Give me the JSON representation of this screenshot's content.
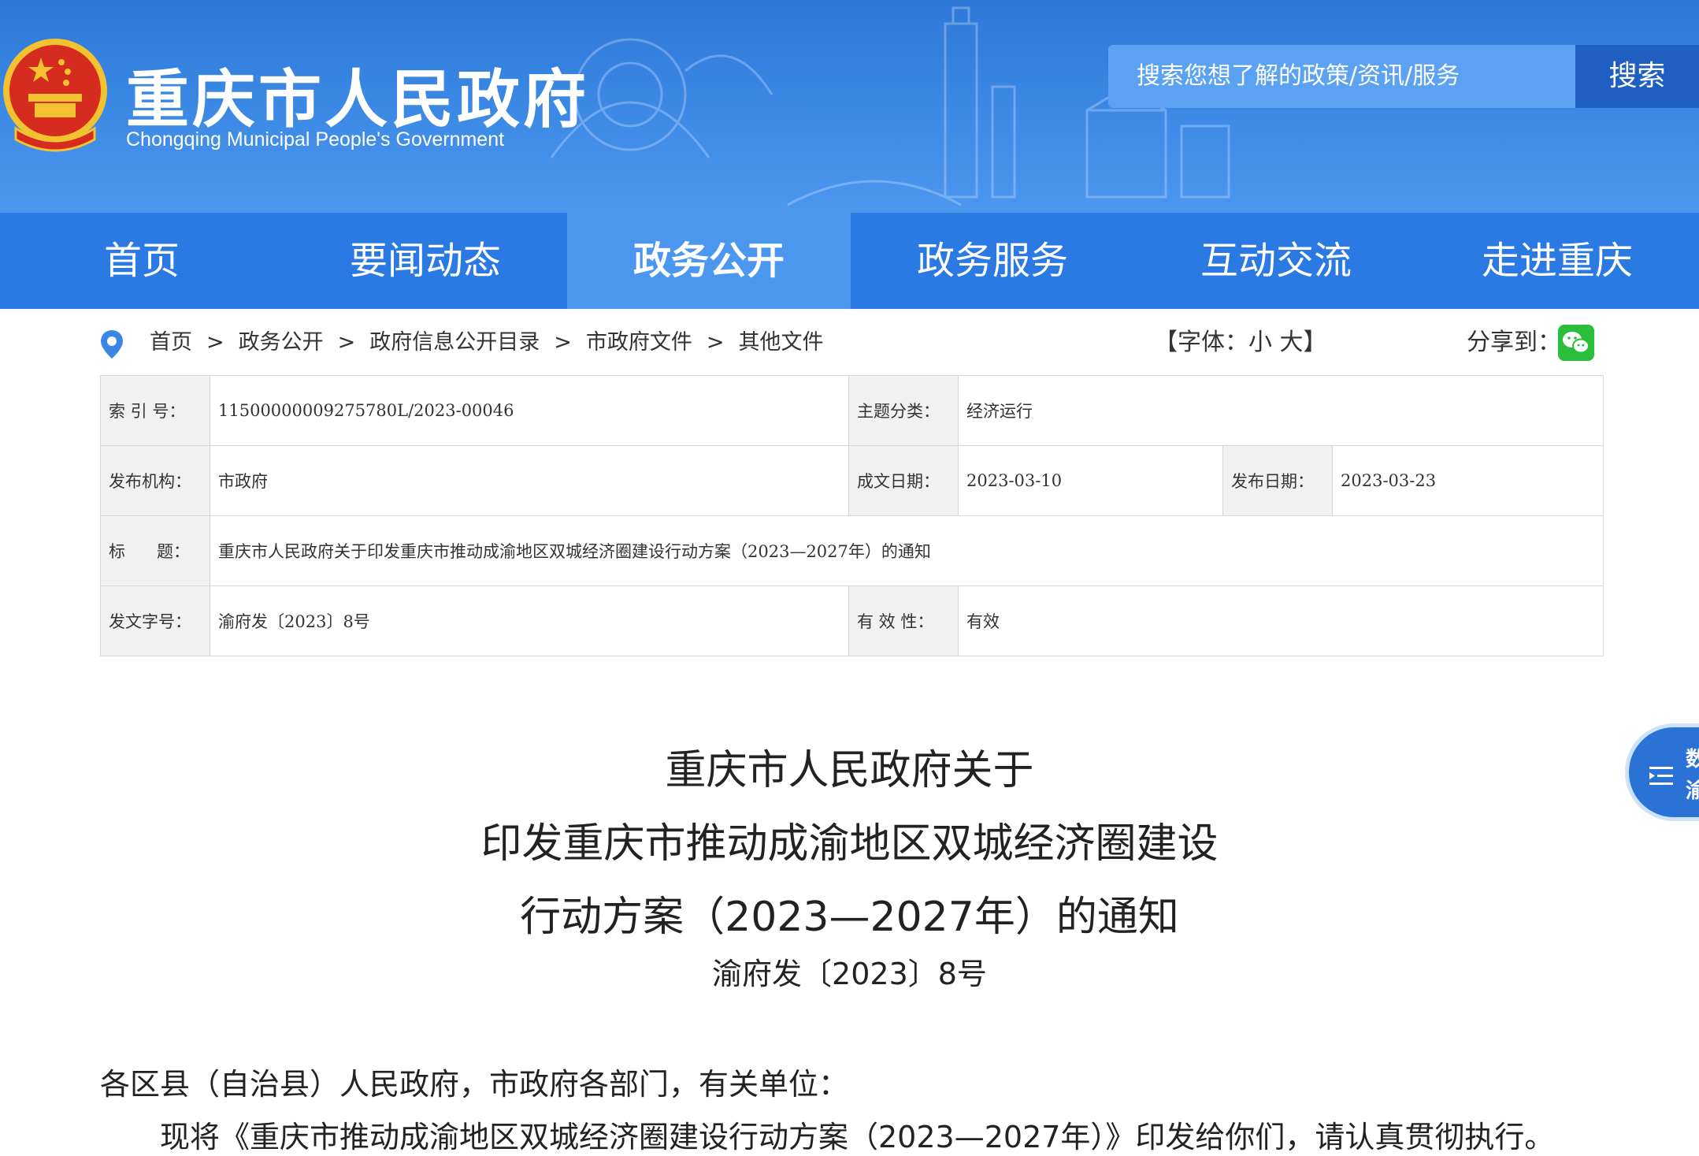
{
  "header": {
    "title": "重庆市人民政府",
    "subtitle": "Chongqing Municipal People's Government",
    "search_placeholder": "搜索您想了解的政策/资讯/服务",
    "search_button": "搜索"
  },
  "nav": {
    "items": [
      {
        "label": "首页"
      },
      {
        "label": "要闻动态"
      },
      {
        "label": "政务公开",
        "active": true
      },
      {
        "label": "政务服务"
      },
      {
        "label": "互动交流"
      },
      {
        "label": "走进重庆"
      }
    ]
  },
  "breadcrumb": {
    "items": [
      "首页",
      "政务公开",
      "政府信息公开目录",
      "市政府文件",
      "其他文件"
    ],
    "separator": ">"
  },
  "tools": {
    "font_size": "【字体：小 大】",
    "share_label": "分享到："
  },
  "info": {
    "index_label": "索  引  号：",
    "index_value": "11500000009275780L/2023-00046",
    "topic_label": "主题分类：",
    "topic_value": "经济运行",
    "publisher_label": "发布机构：",
    "publisher_value": "市政府",
    "written_label": "成文日期：",
    "written_value": "2023-03-10",
    "published_label": "发布日期：",
    "published_value": "2023-03-23",
    "title_label": "标      题：",
    "title_value": "重庆市人民政府关于印发重庆市推动成渝地区双城经济圈建设行动方案（2023—2027年）的通知",
    "docno_label": "发文字号：",
    "docno_value": "渝府发〔2023〕8号",
    "validity_label": "有  效  性：",
    "validity_value": "有效"
  },
  "article": {
    "title_line1": "重庆市人民政府关于",
    "title_line2": "印发重庆市推动成渝地区双城经济圈建设",
    "title_line3": "行动方案（2023—2027年）的通知",
    "doc_number": "渝府发〔2023〕8号",
    "salutation": "各区县（自治县）人民政府，市政府各部门，有关单位：",
    "body": "现将《重庆市推动成渝地区双城经济圈建设行动方案（2023—2027年）》印发给你们，请认真贯彻执行。"
  },
  "float_widget": {
    "line1": "数",
    "line2": "渝"
  },
  "colors": {
    "header_blue": "#3d8ae6",
    "nav_blue": "#2b79e3",
    "nav_active": "#4b96ee",
    "search_button": "#1f5fc1",
    "wechat_green": "#2bbd3c"
  }
}
